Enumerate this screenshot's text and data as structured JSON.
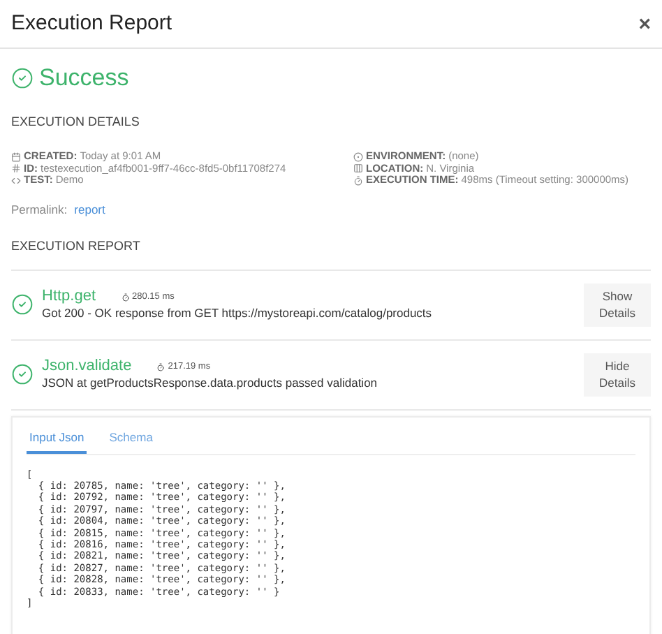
{
  "window": {
    "title": "Execution Report",
    "close": "×"
  },
  "status": {
    "kind": "success",
    "label": "Success"
  },
  "details": {
    "heading": "EXECUTION DETAILS",
    "left": [
      {
        "kind": "calendar",
        "label": "CREATED:",
        "value": "Today at 9:01 AM"
      },
      {
        "kind": "hash",
        "label": "ID:",
        "value": "testexecution_af4fb001-9ff7-46cc-8fd5-0bf11708f274"
      },
      {
        "kind": "code",
        "label": "TEST:",
        "value": "Demo"
      }
    ],
    "right": [
      {
        "kind": "target",
        "label": "ENVIRONMENT:",
        "value": "(none)"
      },
      {
        "kind": "columns",
        "label": "LOCATION:",
        "value": "N. Virginia"
      },
      {
        "kind": "timer",
        "label": "EXECUTION TIME:",
        "value": "498ms (Timeout setting: 300000ms)"
      }
    ],
    "permalink_label": "Permalink:",
    "permalink": "report"
  },
  "report": {
    "heading": "EXECUTION REPORT",
    "steps": [
      {
        "name": "Http.get",
        "duration": "280.15 ms",
        "message": "Got 200 - OK response from GET https://mystoreapi.com/catalog/products",
        "button": [
          "Show",
          "Details"
        ]
      },
      {
        "name": "Json.validate",
        "duration": "217.19 ms",
        "message": "JSON at getProductsResponse.data.products passed validation",
        "button": [
          "Hide",
          "Details"
        ]
      }
    ]
  },
  "panel": {
    "tabs": [
      {
        "label": "Input Json",
        "selected": true
      },
      {
        "label": "Schema",
        "selected": false
      }
    ],
    "code": [
      "[",
      "  { id: 20785, name: 'tree', category: '' },",
      "  { id: 20792, name: 'tree', category: '' },",
      "  { id: 20797, name: 'tree', category: '' },",
      "  { id: 20804, name: 'tree', category: '' },",
      "  { id: 20815, name: 'tree', category: '' },",
      "  { id: 20816, name: 'tree', category: '' },",
      "  { id: 20821, name: 'tree', category: '' },",
      "  { id: 20827, name: 'tree', category: '' },",
      "  { id: 20828, name: 'tree', category: '' },",
      "  { id: 20833, name: 'tree', category: '' }",
      "]"
    ]
  }
}
